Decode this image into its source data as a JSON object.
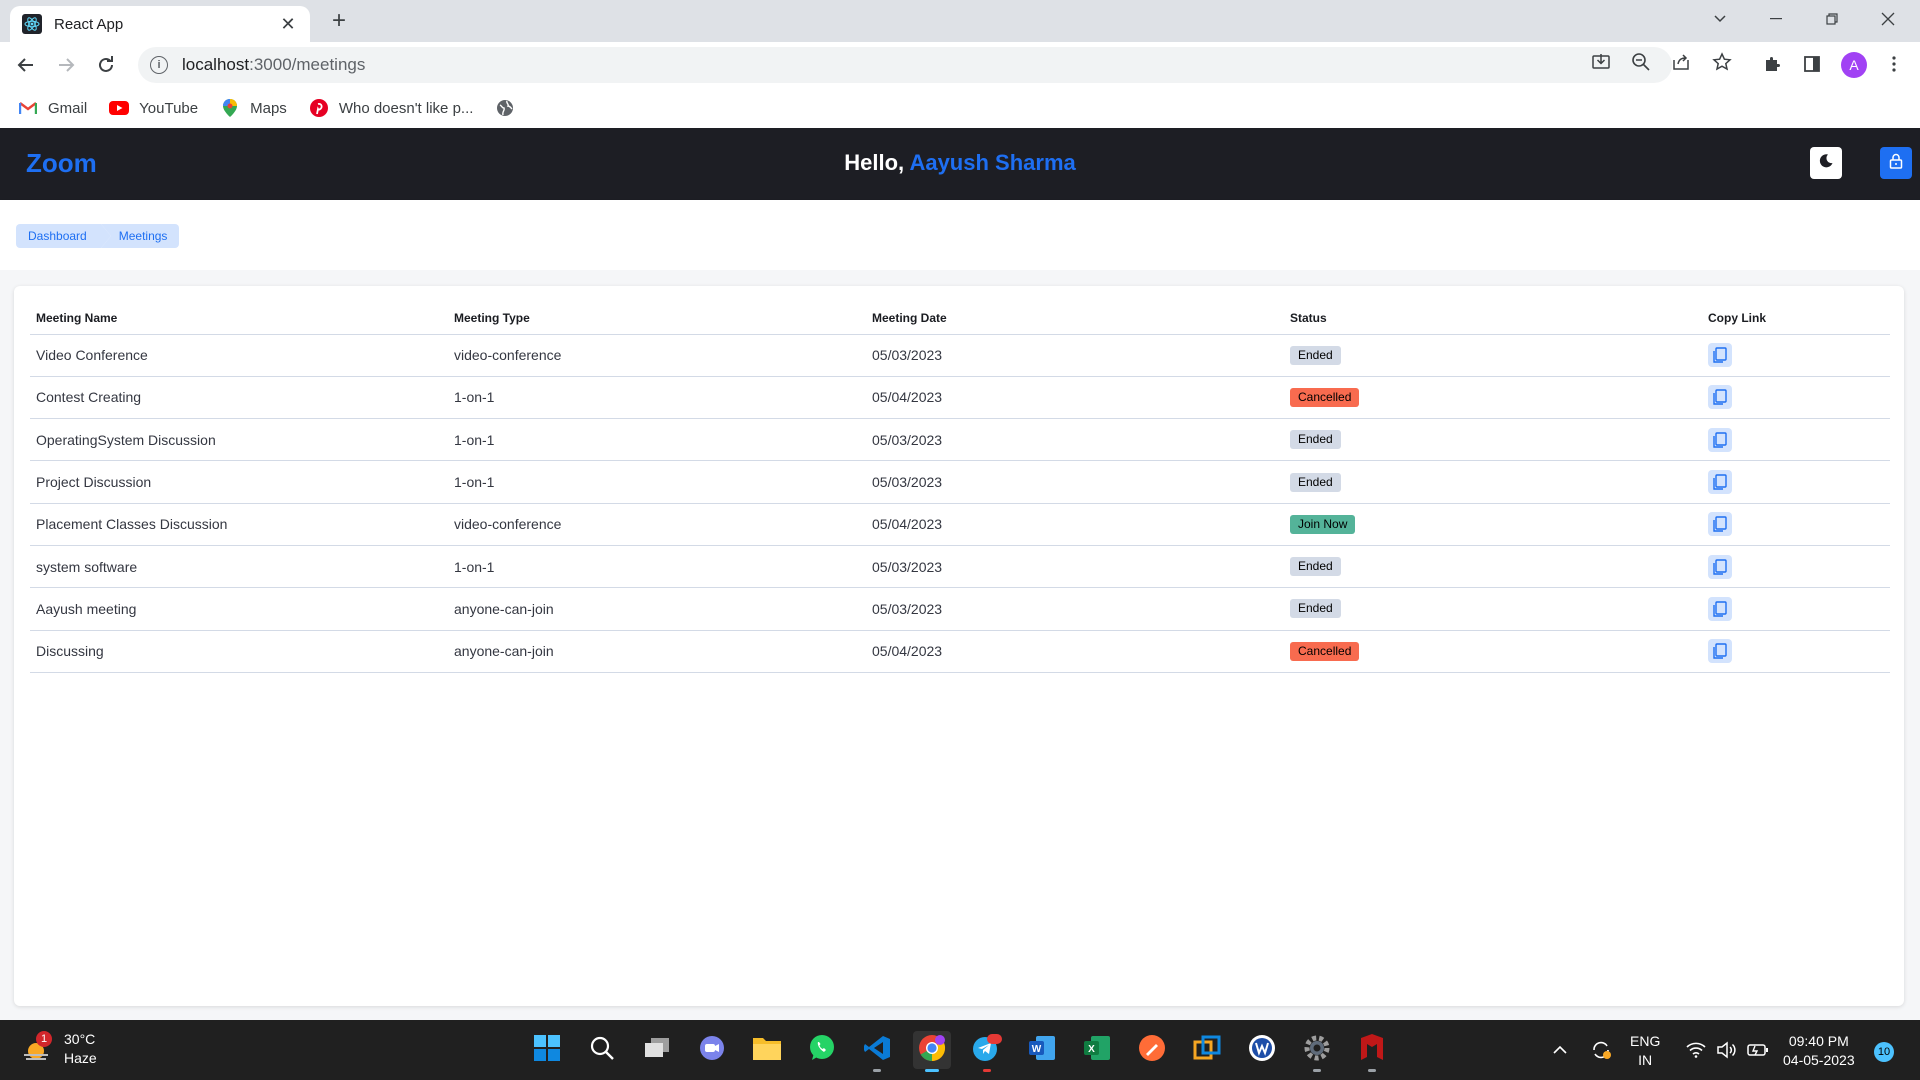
{
  "browser": {
    "tab_title": "React App",
    "url_host": "localhost",
    "url_path": ":3000/meetings",
    "profile_initial": "A",
    "bookmarks": [
      {
        "label": "Gmail",
        "icon": "gmail-icon"
      },
      {
        "label": "YouTube",
        "icon": "youtube-icon"
      },
      {
        "label": "Maps",
        "icon": "maps-icon"
      },
      {
        "label": "Who doesn't like p...",
        "icon": "pinterest-icon"
      }
    ]
  },
  "header": {
    "logo": "Zoom",
    "greeting": "Hello, ",
    "user_name": "Aayush Sharma"
  },
  "breadcrumb": [
    "Dashboard",
    "Meetings"
  ],
  "table": {
    "columns": [
      "Meeting Name",
      "Meeting Type",
      "Meeting Date",
      "Status",
      "Copy Link"
    ],
    "rows": [
      {
        "name": "Video Conference",
        "type": "video-conference",
        "date": "05/03/2023",
        "status": "Ended"
      },
      {
        "name": "Contest Creating",
        "type": "1-on-1",
        "date": "05/04/2023",
        "status": "Cancelled"
      },
      {
        "name": "OperatingSystem Discussion",
        "type": "1-on-1",
        "date": "05/03/2023",
        "status": "Ended"
      },
      {
        "name": "Project Discussion",
        "type": "1-on-1",
        "date": "05/03/2023",
        "status": "Ended"
      },
      {
        "name": "Placement Classes Discussion",
        "type": "video-conference",
        "date": "05/04/2023",
        "status": "Join Now"
      },
      {
        "name": "system software",
        "type": "1-on-1",
        "date": "05/03/2023",
        "status": "Ended"
      },
      {
        "name": "Aayush meeting",
        "type": "anyone-can-join",
        "date": "05/03/2023",
        "status": "Ended"
      },
      {
        "name": "Discussing",
        "type": "anyone-can-join",
        "date": "05/04/2023",
        "status": "Cancelled"
      }
    ]
  },
  "status_colors": {
    "Ended": "#d3dae6",
    "Cancelled": "#f86b4f",
    "Join Now": "#54b399"
  },
  "colors": {
    "accent": "#1e6ff2",
    "header_bg": "#1d1e24"
  },
  "taskbar": {
    "weather_temp": "30°C",
    "weather_desc": "Haze",
    "weather_badge": "1",
    "telegram_badge": "925",
    "lang_1": "ENG",
    "lang_2": "IN",
    "time": "09:40 PM",
    "date": "04-05-2023",
    "notifications": "10"
  }
}
